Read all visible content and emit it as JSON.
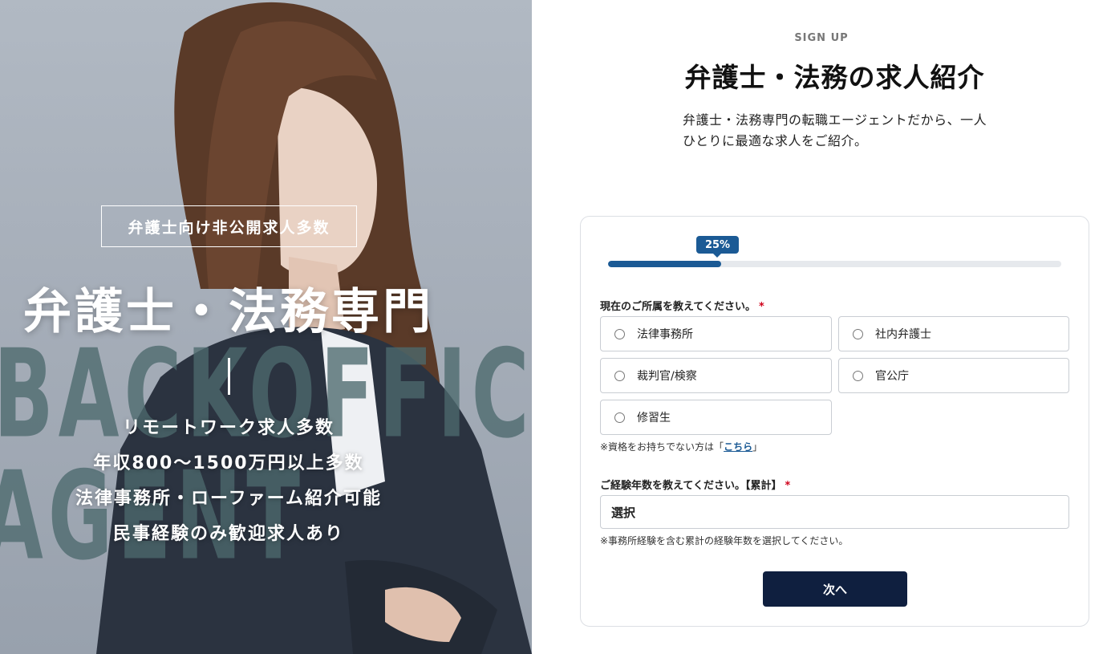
{
  "hero": {
    "bg_word_1": "BACKOFFICE",
    "bg_word_2": "AGENT",
    "badge": "弁護士向け非公開求人多数",
    "title": "弁護士・法務専門",
    "points": [
      "リモートワーク求人多数",
      "年収800〜1500万円以上多数",
      "法律事務所・ローファーム紹介可能",
      "民事経験のみ歓迎求人あり"
    ]
  },
  "header": {
    "signup_label": "SIGN UP",
    "title": "弁護士・法務の求人紹介",
    "description": "弁護士・法務専門の転職エージェントだから、一人ひとりに最適な求人をご紹介。"
  },
  "form": {
    "progress": {
      "label": "25%",
      "value": 0.25
    },
    "question1": {
      "label": "現在のご所属を教えてください。",
      "required_mark": "*",
      "options": [
        "法律事務所",
        "社内弁護士",
        "裁判官/検察",
        "官公庁",
        "修習生"
      ],
      "note_prefix": "※資格をお持ちでない方は「",
      "note_link": "こちら",
      "note_suffix": "」"
    },
    "question2": {
      "label": "ご経験年数を教えてください。【累計】",
      "required_mark": "*",
      "select_value": "選択",
      "note": "※事務所経験を含む累計の経験年数を選択してください。"
    },
    "next_button": "次へ"
  },
  "colors": {
    "accent": "#1b5a95",
    "button": "#0f1f3f",
    "required": "#d0021b",
    "hero_text": "#ffffff"
  }
}
